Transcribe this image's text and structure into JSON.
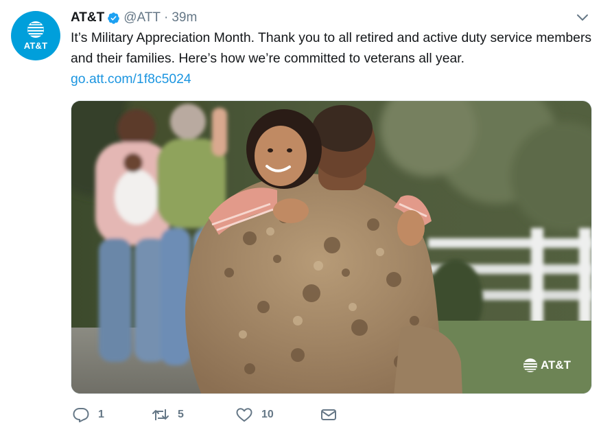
{
  "tweet": {
    "avatar_text": "AT&T",
    "name": "AT&T",
    "handle": "@ATT",
    "separator": "·",
    "time": "39m",
    "text": "It’s Military Appreciation Month. Thank you to all retired and active duty service members and their families. Here’s how we’re committed to veterans all year.",
    "link": "go.att.com/1f8c5024",
    "media": {
      "watermark": "AT&T"
    },
    "actions": {
      "reply_count": "1",
      "retweet_count": "5",
      "like_count": "10"
    }
  },
  "icons": {
    "avatar": "att-globe-icon",
    "verified": "verified-badge-icon",
    "menu": "chevron-down-icon",
    "reply": "reply-icon",
    "retweet": "retweet-icon",
    "like": "heart-icon",
    "dm": "envelope-icon"
  },
  "colors": {
    "brand": "#009fdb",
    "link": "#1b95e0",
    "muted": "#657786",
    "text": "#14171a"
  }
}
